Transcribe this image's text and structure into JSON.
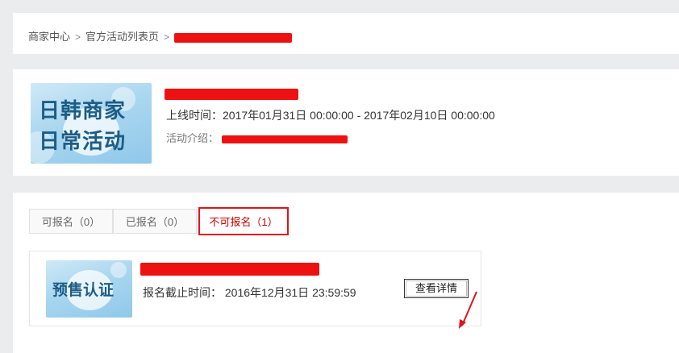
{
  "breadcrumb": {
    "items": [
      "商家中心",
      "官方活动列表页"
    ],
    "separator": ">"
  },
  "activity_info": {
    "banner_line1": "日韩商家",
    "banner_line2": "日常活动",
    "online_time": "上线时间：2017年01月31日 00:00:00 - 2017年02月10日 00:00:00",
    "intro_label": "活动介绍："
  },
  "tabs": [
    {
      "label": "可报名（0）"
    },
    {
      "label": "已报名（0）"
    },
    {
      "label": "不可报名（1）"
    }
  ],
  "activity_item": {
    "banner_text": "预售认证",
    "deadline": "报名截止时间： 2016年12月31日 23:59:59",
    "detail_button": "查看详情"
  },
  "colors": {
    "redaction": "#ee1111",
    "active_tab_border": "#e0141a",
    "page_bg": "#ebecee"
  }
}
